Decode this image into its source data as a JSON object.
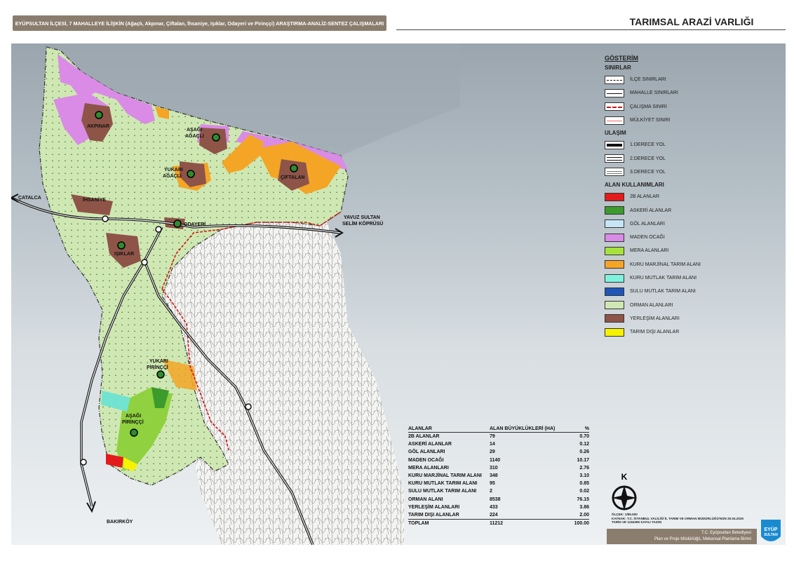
{
  "header": {
    "study_title": "EYÜPSULTAN İLÇESİ, 7 MAHALLEYE İLİŞKİN (Ağaçlı, Akpınar, Çiftalan, İhsaniye, Işıklar, Odayeri ve Pirinççi) ARAŞTIRMA-ANALİZ-SENTEZ ÇALIŞMALARI",
    "map_title": "TARIMSAL ARAZİ VARLIĞI"
  },
  "map": {
    "places": {
      "akpinar": "AKPINAR",
      "asagi_agacli_1": "AŞAĞI",
      "asagi_agacli_2": "AĞAÇLI",
      "yukari_agacli_1": "YUKARI",
      "yukari_agacli_2": "AĞAÇLI",
      "ciftalan": "ÇİFTALAN",
      "ihsaniye": "İHSANİYE",
      "odayeri": "ODAYERİ",
      "isiklar": "IŞIKLAR",
      "yukari_pirincci_1": "YUKARI",
      "yukari_pirincci_2": "PİRİNÇÇİ",
      "asagi_pirincci_1": "AŞAĞI",
      "asagi_pirincci_2": "PİRİNÇÇİ"
    },
    "directions": {
      "catalca": "ÇATALCA",
      "yavuz_1": "YAVUZ SULTAN",
      "yavuz_2": "SELİM KÖPRÜSÜ",
      "bakirkoy": "BAKIRKÖY"
    },
    "compass_letter": "K",
    "colors": {
      "forest": "#cfe8b3",
      "mining": "#d98be6",
      "settlement": "#8e5448",
      "dry_marginal": "#f4a526",
      "pasture": "#8fd13f",
      "military": "#3d9a2c",
      "irrigated": "#72e3d0",
      "outside": "#f6f16a",
      "zone_2b": "#e41b1b",
      "boundary_red": "#d01515"
    }
  },
  "legend": {
    "title": "GÖSTERİM",
    "boundaries_title": "SINIRLAR",
    "boundaries": [
      "İLÇE SINIRLARI",
      "MAHALLE SINIRLARI",
      "ÇALIŞMA SINIRI",
      "MÜLKİYET SINIRI"
    ],
    "transport_title": "ULAŞIM",
    "transport": [
      "1.DERECE YOL",
      "2.DERECE YOL",
      "3.DERECE YOL"
    ],
    "landuse_title": "ALAN KULLANIMLARI",
    "landuse": [
      {
        "label": "2B ALANLAR",
        "color": "#e41b1b"
      },
      {
        "label": "ASKERİ ALANLAR",
        "color": "#3d9a2c"
      },
      {
        "label": "GÖL ALANLARI",
        "color": "#c6e6f7"
      },
      {
        "label": "MADEN OCAĞI",
        "color": "#d98be6"
      },
      {
        "label": "MERA ALANLARI",
        "color": "#a6e23b"
      },
      {
        "label": "KURU MARJİNAL TARIM ALANI",
        "color": "#f4a526"
      },
      {
        "label": "KURU MUTLAK TARIM ALANI",
        "color": "#7ff2dd"
      },
      {
        "label": "SULU MUTLAK TARIM ALANI",
        "color": "#1f56b8"
      },
      {
        "label": "ORMAN ALANLARI",
        "color": "#cfe8b3"
      },
      {
        "label": "YERLEŞİM ALANLARI",
        "color": "#8e5448"
      },
      {
        "label": "TARIM DIŞI ALANLAR",
        "color": "#f6f200"
      }
    ]
  },
  "stats": {
    "headers": [
      "ALANLAR",
      "ALAN BÜYÜKLÜKLERİ (HA)",
      "%"
    ],
    "rows": [
      [
        "2B ALANLAR",
        "79",
        "0.70"
      ],
      [
        "ASKERİ ALANLAR",
        "14",
        "0.12"
      ],
      [
        "GÖL ALANLARI",
        "29",
        "0.26"
      ],
      [
        "MADEN OCAĞI",
        "1140",
        "10.17"
      ],
      [
        "MERA ALANLARI",
        "310",
        "2.76"
      ],
      [
        "KURU MARJİNAL TARIM ALANI",
        "348",
        "3.10"
      ],
      [
        "KURU MUTLAK TARIM ALANI",
        "95",
        "0.85"
      ],
      [
        "SULU MUTLAK TARIM ALANI",
        "2",
        "0.02"
      ],
      [
        "ORMAN ALANI",
        "8538",
        "76.15"
      ],
      [
        "YERLEŞİM ALANLARI",
        "433",
        "3.86"
      ],
      [
        "TARIM DIŞI ALANLAR",
        "224",
        "2.00"
      ]
    ],
    "total": [
      "TOPLAM",
      "11212",
      "100.00"
    ]
  },
  "source": {
    "scale": "ÖLÇEK: 1/95.000",
    "line1": "KAYNAK: T.C. İSTANBUL VALİLİĞİ İL TARIM VE ORMAN MÜDÜRLÜĞÜ'NÜN 20.04.2020",
    "line2": "TARİH VE 1194395 SAYILI YAZISI"
  },
  "footer": {
    "line1": "T.C. Eyüpsultan Belediyesi",
    "line2": "Plan ve Proje Müdürlüğü, Mekansal Planlama Birimi",
    "logo_1": "EYÜP",
    "logo_2": "SULTAN"
  }
}
